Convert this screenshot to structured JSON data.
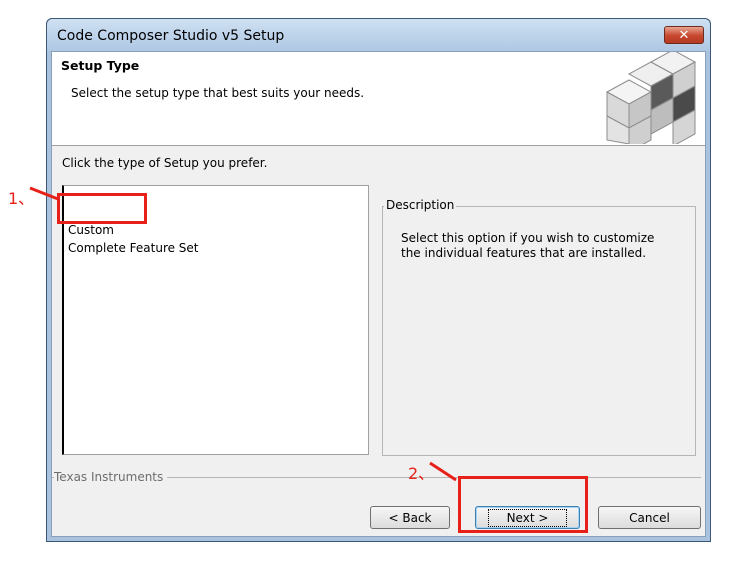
{
  "window": {
    "title": "Code Composer Studio v5 Setup",
    "close_symbol": "✕"
  },
  "header": {
    "title": "Setup Type",
    "subtitle": "Select the setup type that best suits your needs.",
    "logo_icon": "cube-logo-icon"
  },
  "prompt": "Click the type of Setup you prefer.",
  "setup_types": [
    {
      "label": "Custom",
      "selected": true
    },
    {
      "label": "Complete Feature Set",
      "selected": false
    }
  ],
  "description": {
    "legend": "Description",
    "text": "Select this option if you wish to customize the individual features that are installed."
  },
  "footer": {
    "company": "Texas Instruments"
  },
  "buttons": {
    "back": "< Back",
    "next": "Next >",
    "cancel": "Cancel"
  },
  "annotations": {
    "step1": "1、",
    "step2": "2、",
    "color": "#e8201a"
  }
}
